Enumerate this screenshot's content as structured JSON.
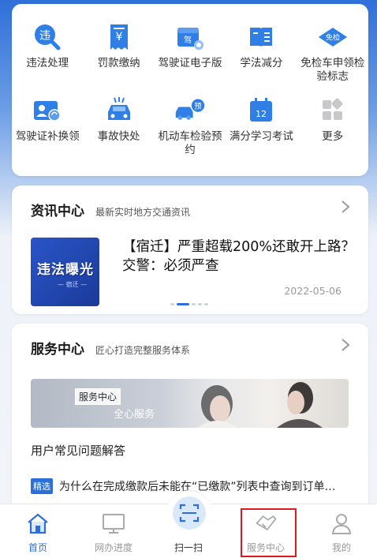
{
  "grid": {
    "items": [
      {
        "label": "违法处理",
        "icon": "violation-search-icon"
      },
      {
        "label": "罚款缴纳",
        "icon": "fine-payment-icon"
      },
      {
        "label": "驾驶证电子版",
        "icon": "e-license-icon"
      },
      {
        "label": "学法减分",
        "icon": "study-book-icon"
      },
      {
        "label": "免检车申领检验标志",
        "icon": "inspection-exempt-icon"
      },
      {
        "label": "驾驶证补换领",
        "icon": "license-renew-icon"
      },
      {
        "label": "事故快处",
        "icon": "accident-car-icon"
      },
      {
        "label": "机动车检验预约",
        "icon": "vehicle-inspection-booking-icon"
      },
      {
        "label": "满分学习考试",
        "icon": "calendar-exam-icon"
      },
      {
        "label": "更多",
        "icon": "more-grid-icon"
      }
    ],
    "badges": {
      "e_license": "驾",
      "violation": "违",
      "exempt": "免检",
      "booking": "预",
      "exam": "12"
    }
  },
  "news": {
    "title": "资讯中心",
    "subtitle": "最新实时地方交通资讯",
    "article": {
      "thumb_title": "违法曝光",
      "thumb_sub": "— 宿迁 —",
      "headline": "【宿迁】严重超载200%还敢开上路？交警：必须严查",
      "date": "2022-05-06"
    }
  },
  "service": {
    "title": "服务中心",
    "subtitle": "匠心打造完整服务体系",
    "banner_tag": "服务中心",
    "banner_text": "全心服务",
    "faq_title": "用户常见问题解答",
    "faq_tag": "精选",
    "faq_item": "为什么在完成缴款后未能在“已缴款”列表中查询到订单…"
  },
  "tabbar": {
    "home": "首页",
    "progress": "网办进度",
    "scan": "扫一扫",
    "service": "服务中心",
    "mine": "我的"
  },
  "colors": {
    "accent": "#2d6fd8",
    "highlight": "#e0191f"
  }
}
